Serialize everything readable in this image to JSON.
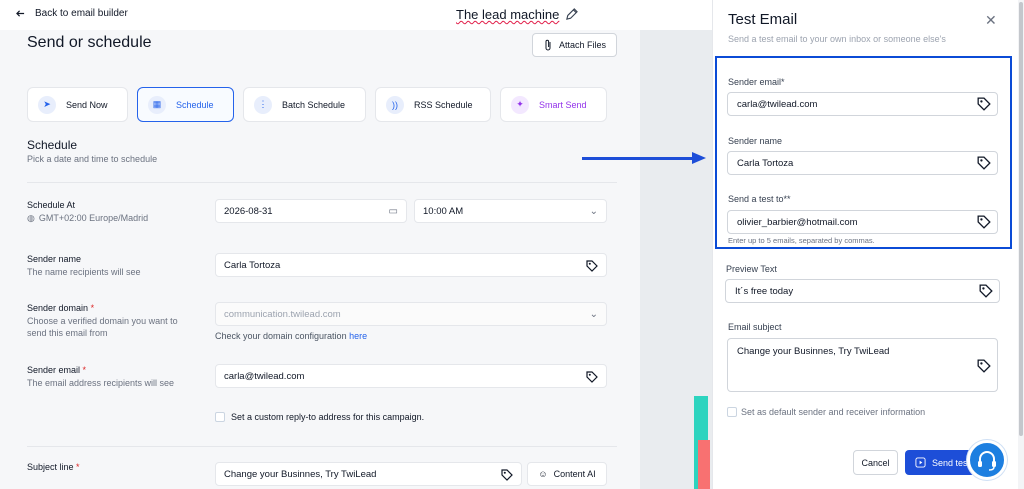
{
  "header": {
    "back_label": "Back to email builder",
    "campaign_title": "The lead machine"
  },
  "page": {
    "title": "Send or schedule",
    "attach_label": "Attach Files"
  },
  "modes": [
    {
      "label": "Send Now",
      "icon": "send-icon"
    },
    {
      "label": "Schedule",
      "icon": "calendar-icon",
      "active": true
    },
    {
      "label": "Batch Schedule",
      "icon": "batch-icon"
    },
    {
      "label": "RSS Schedule",
      "icon": "rss-icon"
    },
    {
      "label": "Smart Send",
      "icon": "wand-icon"
    }
  ],
  "schedule": {
    "title": "Schedule",
    "subtitle": "Pick a date and time to schedule",
    "schedule_at_label": "Schedule At",
    "timezone": "GMT+02:00 Europe/Madrid",
    "date_value": "2026-08-31",
    "time_value": "10:00 AM"
  },
  "sender": {
    "name_label": "Sender name",
    "name_sub": "The name recipients will see",
    "name_value": "Carla Tortoza",
    "domain_label": "Sender domain",
    "domain_sub": "Choose a verified domain you want to send this email from",
    "domain_value": "communication.twilead.com",
    "domain_hint": "Check your domain configuration",
    "domain_hint_link": "here",
    "email_label": "Sender email",
    "email_sub": "The email address recipients will see",
    "email_value": "carla@twilead.com",
    "reply_to_label": "Set a custom reply-to address for this campaign."
  },
  "subject": {
    "label": "Subject line",
    "value": "Change your Businnes, Try TwiLead",
    "content_ai_label": "Content AI"
  },
  "modal": {
    "title": "Test Email",
    "subtitle": "Send a test email to your own inbox or someone else's",
    "sender_email_label": "Sender email*",
    "sender_email_value": "carla@twilead.com",
    "sender_name_label": "Sender name",
    "sender_name_value": "Carla Tortoza",
    "send_to_label": "Send a test to**",
    "send_to_value": "olivier_barbier@hotmail.com",
    "send_to_hint": "Enter up to 5 emails, separated by commas.",
    "preview_label": "Preview Text",
    "preview_value": "It´s free today",
    "subject_label": "Email subject",
    "subject_value": "Change your Businnes, Try TwiLead",
    "default_label": "Set as default sender and receiver information",
    "cancel_label": "Cancel",
    "send_label": "Send test"
  },
  "colors": {
    "accent": "#1d4ed8",
    "highlight_border": "#0b4bd6",
    "required": "#dc2626",
    "smart_send": "#9333ea"
  }
}
